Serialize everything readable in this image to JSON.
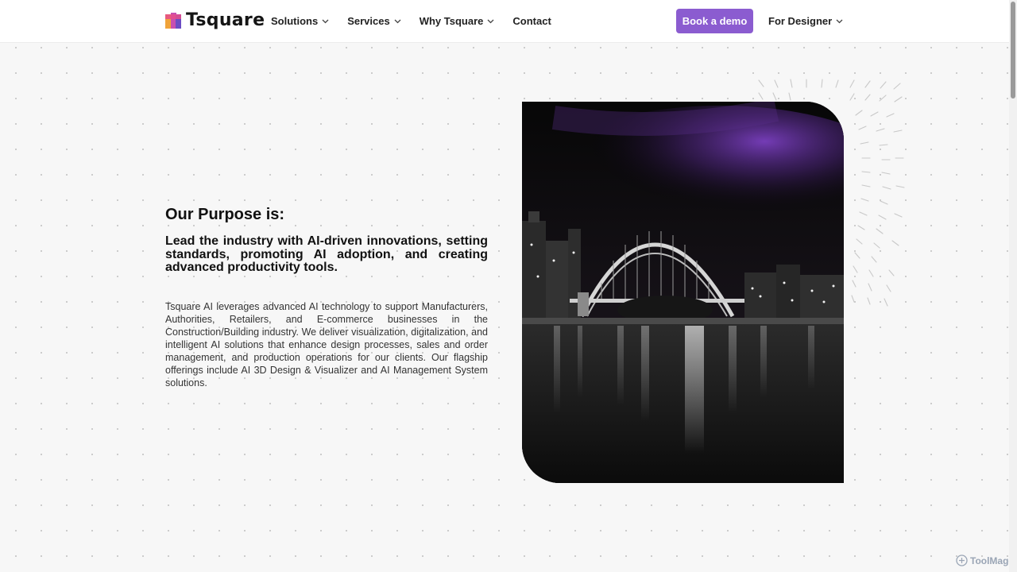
{
  "brand": {
    "name": "Tsquare"
  },
  "nav": {
    "items": [
      {
        "label": "Solutions",
        "has_dropdown": true
      },
      {
        "label": "Services",
        "has_dropdown": true
      },
      {
        "label": "Why Tsquare",
        "has_dropdown": true
      },
      {
        "label": "Contact",
        "has_dropdown": false
      }
    ],
    "cta_label": "Book a demo",
    "designer_label": "For Designer"
  },
  "hero": {
    "title": "Our Purpose is:",
    "lead": "Lead the industry with AI-driven innovations, setting standards, promoting AI adoption, and creating advanced productivity tools.",
    "body": "Tsquare AI leverages advanced AI technology to support Manufacturers, Authorities, Retailers, and E-commerce businesses in the Construction/Building industry. We deliver visualization, digitalization, and intelligent AI solutions that enhance design processes, sales and order management, and production operations for our clients. Our flagship offerings include AI 3D Design & Visualizer and AI Management System solutions."
  },
  "watermark": {
    "text": "ToolMage"
  },
  "icons": {
    "logo": "tsquare-logo-icon",
    "chevron": "chevron-down-icon",
    "image": "harbour-bridge-night-photo",
    "watermark": "toolmage-logo-icon"
  },
  "colors": {
    "accent": "#8b5cd0",
    "header_bg": "#ffffff",
    "page_bg": "#f7f7f7",
    "text": "#111111"
  }
}
